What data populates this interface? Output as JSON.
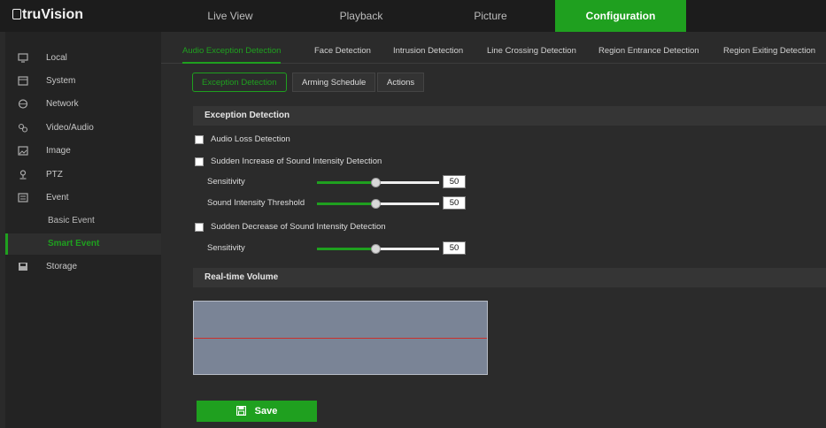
{
  "app": {
    "logo_text": "truVision"
  },
  "top_tabs": [
    {
      "label": "Live View"
    },
    {
      "label": "Playback"
    },
    {
      "label": "Picture"
    },
    {
      "label": "Configuration",
      "active": true
    }
  ],
  "sidebar": {
    "items": [
      {
        "label": "Local",
        "icon": "monitor-icon"
      },
      {
        "label": "System",
        "icon": "system-icon"
      },
      {
        "label": "Network",
        "icon": "globe-icon"
      },
      {
        "label": "Video/Audio",
        "icon": "video-audio-icon"
      },
      {
        "label": "Image",
        "icon": "image-icon"
      },
      {
        "label": "PTZ",
        "icon": "ptz-icon"
      },
      {
        "label": "Event",
        "icon": "event-icon"
      },
      {
        "label": "Storage",
        "icon": "storage-icon"
      }
    ],
    "subitems": [
      {
        "label": "Basic Event"
      },
      {
        "label": "Smart Event",
        "active": true
      }
    ]
  },
  "subtabs": [
    {
      "label": "Audio Exception Detection",
      "active": true
    },
    {
      "label": "Face Detection"
    },
    {
      "label": "Intrusion Detection"
    },
    {
      "label": "Line Crossing Detection"
    },
    {
      "label": "Region Entrance Detection"
    },
    {
      "label": "Region Exiting Detection"
    }
  ],
  "breadcrumbs": [
    {
      "label": "Exception Detection",
      "active": true
    },
    {
      "label": "Arming Schedule"
    },
    {
      "label": "Actions"
    }
  ],
  "exception_detection": {
    "title": "Exception Detection",
    "audio_loss": {
      "label": "Audio Loss Detection",
      "checked": false
    },
    "sudden_increase": {
      "label": "Sudden Increase of Sound Intensity Detection",
      "checked": false,
      "sensitivity": {
        "label": "Sensitivity",
        "value": "50"
      },
      "threshold": {
        "label": "Sound Intensity Threshold",
        "value": "50"
      }
    },
    "sudden_decrease": {
      "label": "Sudden Decrease of Sound Intensity Detection",
      "checked": false,
      "sensitivity": {
        "label": "Sensitivity",
        "value": "50"
      }
    }
  },
  "realtime_volume": {
    "title": "Real-time Volume"
  },
  "save_label": "Save",
  "colors": {
    "accent": "#1fa01f",
    "volume_line": "#c9302c"
  }
}
